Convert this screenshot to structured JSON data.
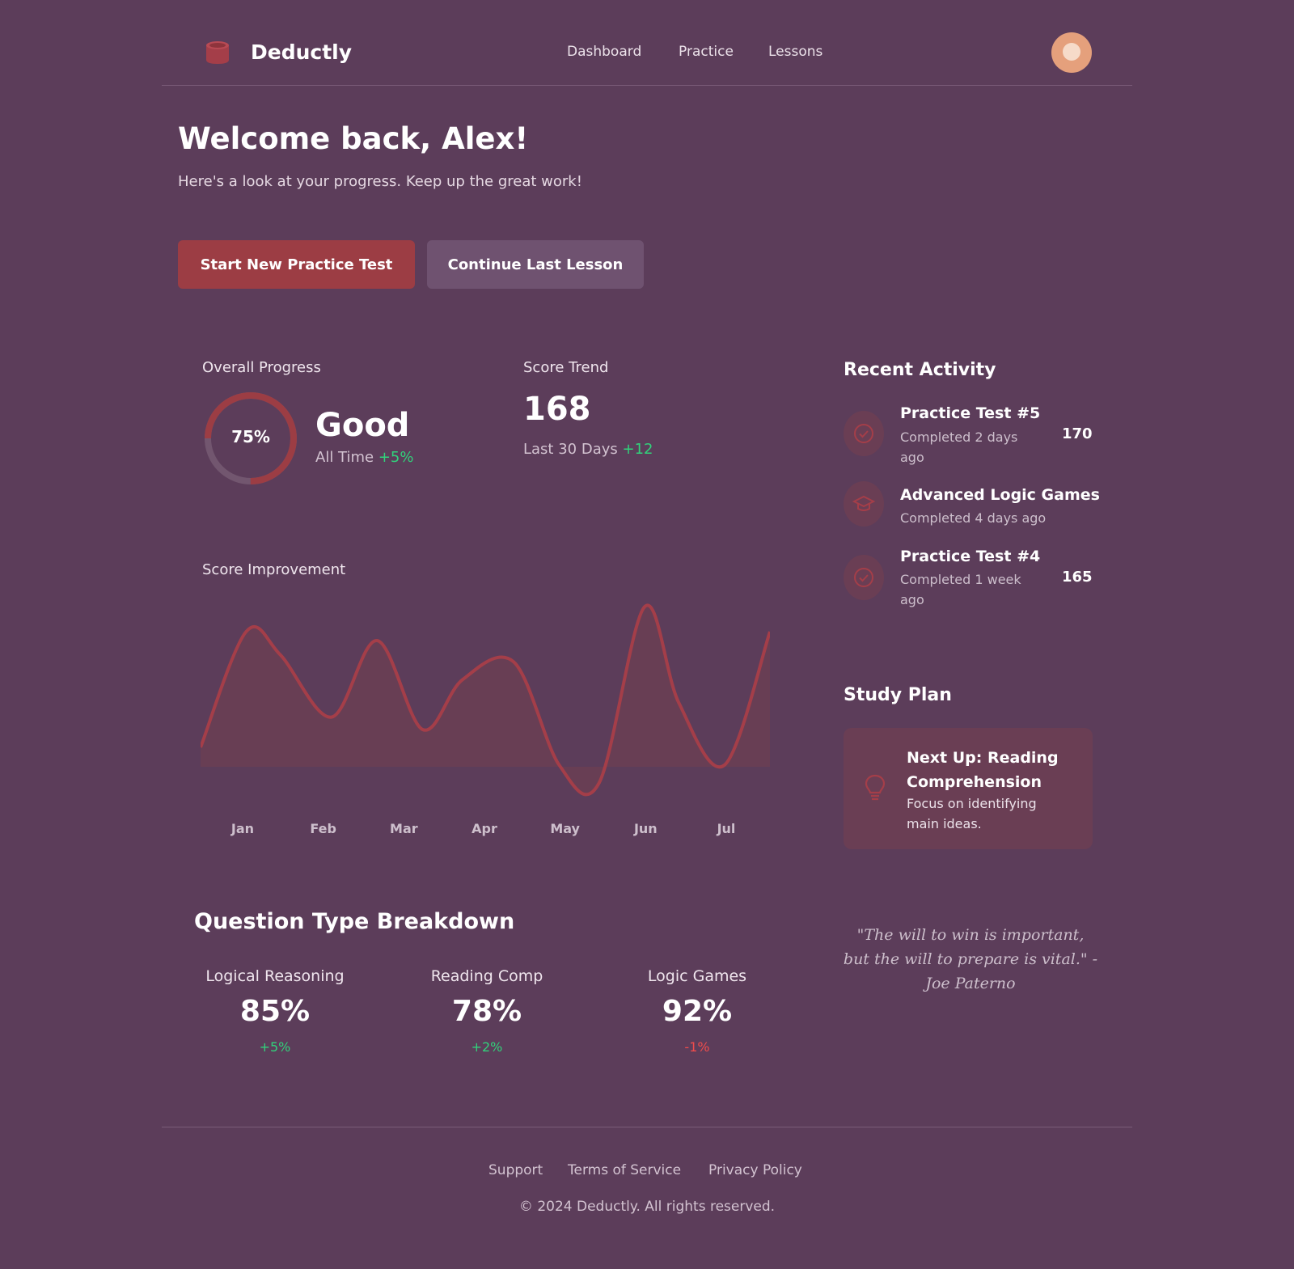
{
  "brand": {
    "name": "Deductly"
  },
  "nav": {
    "items": [
      "Dashboard",
      "Practice",
      "Lessons"
    ]
  },
  "welcome": {
    "title": "Welcome back, Alex!",
    "subtitle": "Here's a look at your progress. Keep up the great work!"
  },
  "actions": {
    "primary": "Start New Practice Test",
    "secondary": "Continue Last Lesson"
  },
  "progress": {
    "label": "Overall Progress",
    "percent_text": "75%",
    "percent": 0.75,
    "rating": "Good",
    "sub": "All Time",
    "delta": "+5%"
  },
  "trend": {
    "label": "Score Trend",
    "value": "168",
    "sub": "Last 30 Days",
    "delta": "+12"
  },
  "improvement": {
    "label": "Score Improvement"
  },
  "chart_data": {
    "type": "area",
    "categories": [
      "Jan",
      "Feb",
      "Mar",
      "Apr",
      "May",
      "Jun",
      "Jul"
    ],
    "x": [
      0,
      0.08,
      0.14,
      0.23,
      0.31,
      0.39,
      0.46,
      0.55,
      0.63,
      0.7,
      0.78,
      0.84,
      0.92,
      1.0
    ],
    "y": [
      0.2,
      0.85,
      0.72,
      0.37,
      0.8,
      0.3,
      0.58,
      0.68,
      0.1,
      0.0,
      0.99,
      0.45,
      0.1,
      0.85
    ],
    "grid": false,
    "colors": {
      "line": "#a43e49",
      "fill": "#6a3e54"
    }
  },
  "activity": {
    "title": "Recent Activity",
    "items": [
      {
        "icon": "check-circle-icon",
        "title": "Practice Test #5",
        "sub1": "Completed 2 days",
        "sub2": "ago",
        "score": "170"
      },
      {
        "icon": "graduation-cap-icon",
        "title": "Advanced Logic Games",
        "sub1": "Completed 4 days ago",
        "sub2": "",
        "score": ""
      },
      {
        "icon": "check-circle-icon",
        "title": "Practice Test #4",
        "sub1": "Completed 1 week",
        "sub2": "ago",
        "score": "165"
      }
    ]
  },
  "study_plan": {
    "title": "Study Plan",
    "card_title_1": "Next Up: Reading",
    "card_title_2": "Comprehension",
    "desc_1": "Focus on identifying",
    "desc_2": "main ideas.",
    "icon": "lightbulb-icon"
  },
  "quote": {
    "line1": "\"The will to win is important,",
    "line2": "but the will to prepare is vital.\" -",
    "line3": "Joe Paterno"
  },
  "breakdown": {
    "title": "Question Type Breakdown",
    "items": [
      {
        "label": "Logical Reasoning",
        "value": "85%",
        "delta": "+5%",
        "trend": "up"
      },
      {
        "label": "Reading Comp",
        "value": "78%",
        "delta": "+2%",
        "trend": "up"
      },
      {
        "label": "Logic Games",
        "value": "92%",
        "delta": "-1%",
        "trend": "down"
      }
    ]
  },
  "footer": {
    "links": [
      "Support",
      "Terms of Service",
      "Privacy Policy"
    ],
    "copyright": "© 2024 Deductly. All rights reserved."
  },
  "colors": {
    "background": "#5c3d5a",
    "accent": "#9c3d44",
    "positive": "#31d27b",
    "negative": "#ef4c4c"
  }
}
